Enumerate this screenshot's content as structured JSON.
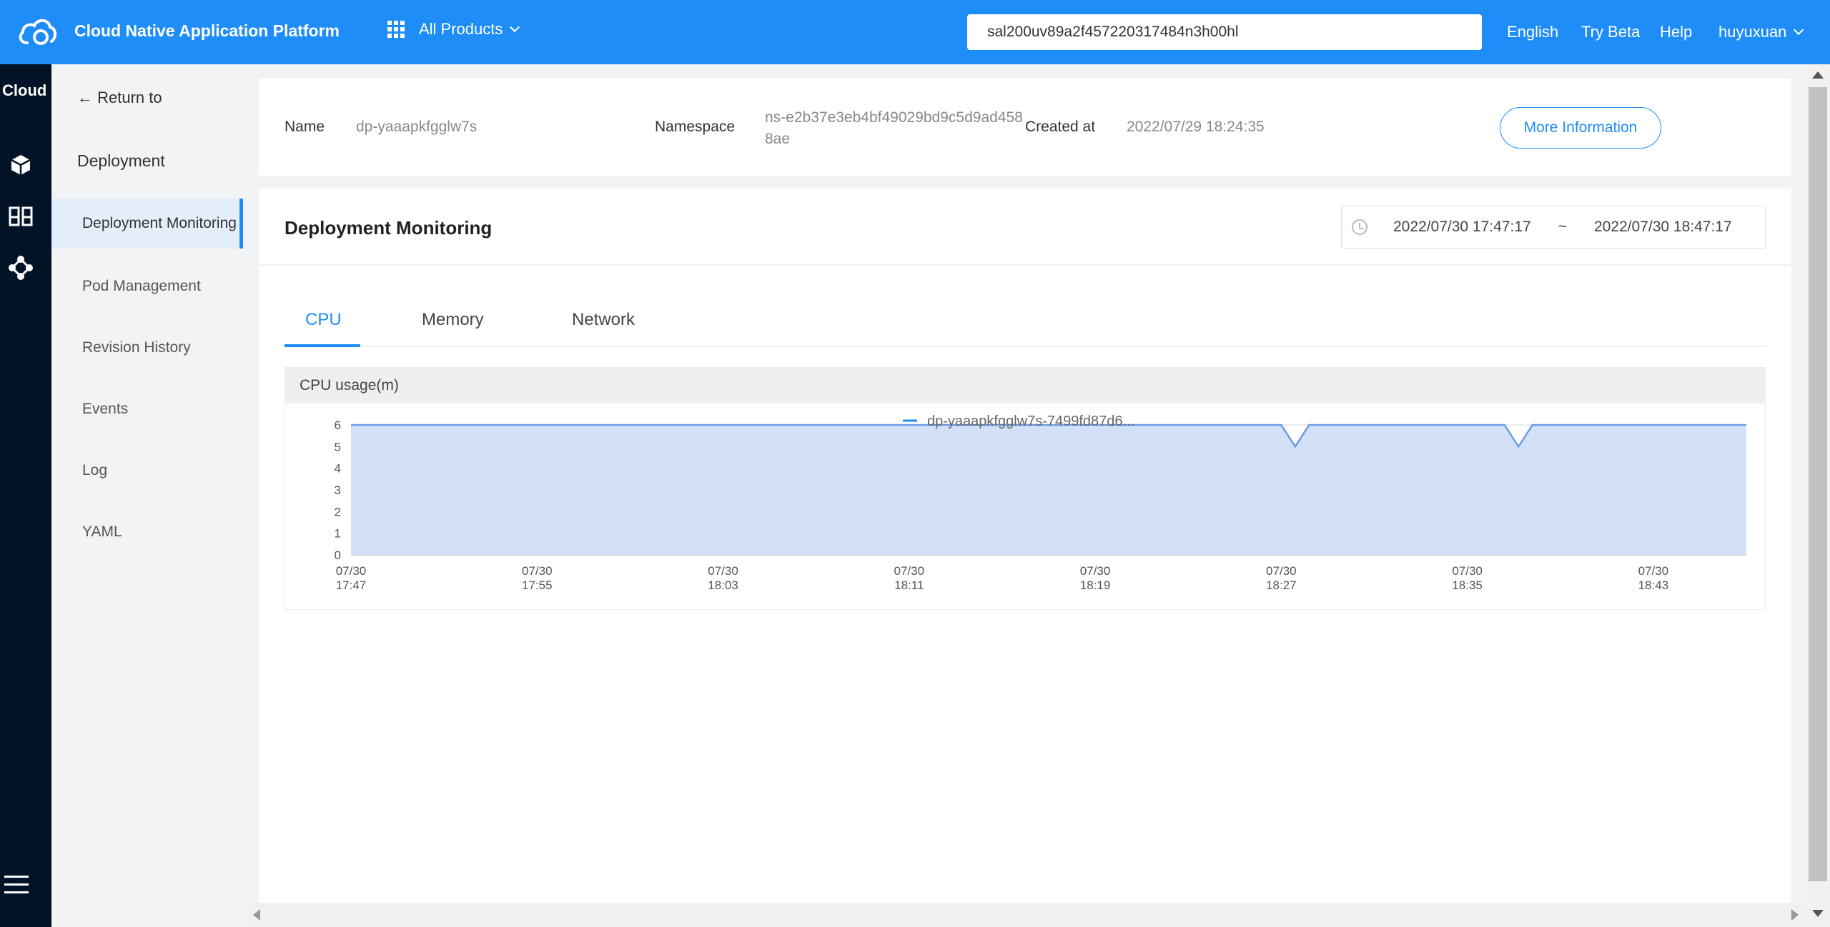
{
  "topbar": {
    "app_title": "Cloud Native Application Platform",
    "products_label": "All Products",
    "search_value": "sal200uv89a2f457220317484n3h00hl",
    "links": [
      "English",
      "Try Beta",
      "Help"
    ],
    "user": "huyuxuan"
  },
  "darkbar": {
    "title": "Cloud"
  },
  "subnav": {
    "return_label": "← Return to",
    "section_label": "Deployment",
    "items": [
      "Deployment Monitoring",
      "Pod Management",
      "Revision History",
      "Events",
      "Log",
      "YAML"
    ],
    "active_index": 0
  },
  "info": {
    "name_label": "Name",
    "name_value": "dp-yaaapkfgglw7s",
    "namespace_label": "Namespace",
    "namespace_value": "ns-e2b37e3eb4bf49029bd9c5d9ad4588ae",
    "created_label": "Created at",
    "created_value": "2022/07/29 18:24:35",
    "more_button": "More Information"
  },
  "monitoring": {
    "title": "Deployment Monitoring",
    "range_start": "2022/07/30 17:47:17",
    "range_sep": "~",
    "range_end": "2022/07/30 18:47:17",
    "tabs": [
      "CPU",
      "Memory",
      "Network"
    ],
    "active_tab": 0,
    "chart_title": "CPU usage(m)"
  },
  "colors": {
    "brand": "#1e8df8",
    "series_line": "#6a9be8",
    "series_fill": "#d3e1f8",
    "sidebar_dark": "#021328"
  },
  "chart_data": {
    "type": "area",
    "title": "CPU usage(m)",
    "ylim": [
      0,
      6
    ],
    "yticks": [
      0,
      1,
      2,
      3,
      4,
      5,
      6
    ],
    "x_ticks": [
      {
        "minute": 0,
        "label": [
          "07/30",
          "17:47"
        ]
      },
      {
        "minute": 8,
        "label": [
          "07/30",
          "17:55"
        ]
      },
      {
        "minute": 16,
        "label": [
          "07/30",
          "18:03"
        ]
      },
      {
        "minute": 24,
        "label": [
          "07/30",
          "18:11"
        ]
      },
      {
        "minute": 32,
        "label": [
          "07/30",
          "18:19"
        ]
      },
      {
        "minute": 40,
        "label": [
          "07/30",
          "18:27"
        ]
      },
      {
        "minute": 48,
        "label": [
          "07/30",
          "18:35"
        ]
      },
      {
        "minute": 56,
        "label": [
          "07/30",
          "18:43"
        ]
      }
    ],
    "x_range_minutes": [
      0,
      60
    ],
    "legend_position": "top-center",
    "series": [
      {
        "name": "dp-yaaapkfgglw7s-7499fd87d6...",
        "points": [
          [
            0,
            6
          ],
          [
            40,
            6
          ],
          [
            40.6,
            5
          ],
          [
            41.2,
            6
          ],
          [
            49.6,
            6
          ],
          [
            50.2,
            5
          ],
          [
            50.8,
            6
          ],
          [
            60,
            6
          ]
        ]
      }
    ]
  }
}
